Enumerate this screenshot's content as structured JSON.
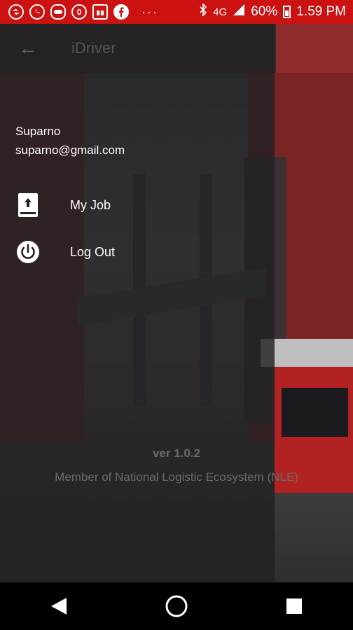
{
  "status_bar": {
    "notification_icons": [
      "notification-icon",
      "whatsapp-icon",
      "line-icon",
      "opera-icon",
      "gift-icon",
      "facebook-icon"
    ],
    "more_dots": "···",
    "signal_label": "4G",
    "battery_percent": "60%",
    "time": "1.59 PM"
  },
  "app_bar": {
    "title": "iDriver"
  },
  "drawer": {
    "user_name": "Suparno",
    "user_email": "suparno@gmail.com",
    "menu": [
      {
        "label": "My Job",
        "icon": "job-book-icon"
      },
      {
        "label": "Log Out",
        "icon": "power-icon"
      }
    ],
    "version": "ver 1.0.2",
    "member_text": "Member of National Logistic Ecosystem (NLE)"
  },
  "nav_bar": {
    "buttons": [
      "back-nav-icon",
      "home-nav-icon",
      "recents-nav-icon"
    ]
  },
  "colors": {
    "status_bar": "#cc1111",
    "drawer_overlay": "#202022",
    "text": "#ffffff"
  }
}
